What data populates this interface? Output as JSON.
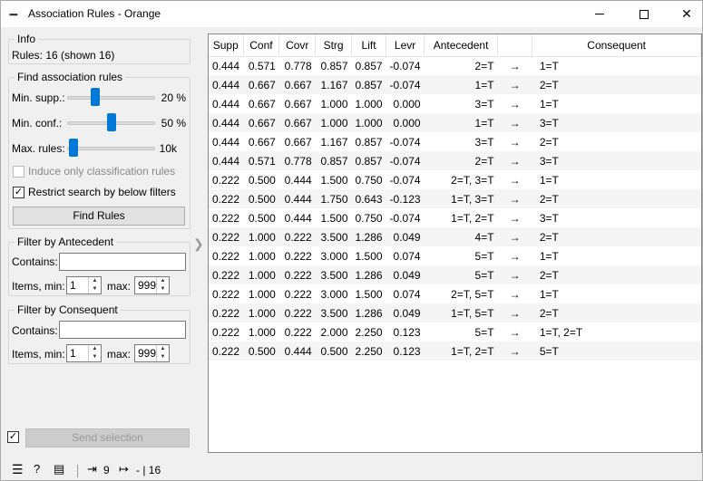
{
  "window": {
    "title": "Association Rules - Orange",
    "app_icon": "orange-dots-icon"
  },
  "info": {
    "title": "Info",
    "rules_text": "Rules: 16 (shown 16)"
  },
  "find": {
    "title": "Find association rules",
    "min_supp_label": "Min. supp.:",
    "min_supp_value": "20 %",
    "min_supp_level": 0.3,
    "min_conf_label": "Min. conf.:",
    "min_conf_value": "50 %",
    "min_conf_level": 0.5,
    "max_rules_label": "Max. rules:",
    "max_rules_value": "10k",
    "max_rules_level": 0.02,
    "induce_label": "Induce only classification rules",
    "induce_checked": false,
    "restrict_label": "Restrict search by below filters",
    "restrict_checked": true,
    "find_button": "Find Rules"
  },
  "filter_antecedent": {
    "title": "Filter by Antecedent",
    "contains_label": "Contains:",
    "contains_value": "",
    "items_min_label": "Items, min:",
    "items_min_value": "1",
    "max_label": "max:",
    "max_value": "999"
  },
  "filter_consequent": {
    "title": "Filter by Consequent",
    "contains_label": "Contains:",
    "contains_value": "",
    "items_min_label": "Items, min:",
    "items_min_value": "1",
    "max_label": "max:",
    "max_value": "999"
  },
  "send": {
    "auto_send_checked": true,
    "button": "Send selection"
  },
  "table": {
    "headers": [
      "Supp",
      "Conf",
      "Covr",
      "Strg",
      "Lift",
      "Levr",
      "Antecedent",
      "",
      "Consequent"
    ],
    "rows": [
      [
        "0.444",
        "0.571",
        "0.778",
        "0.857",
        "0.857",
        "-0.074",
        "2=T",
        "→",
        "1=T"
      ],
      [
        "0.444",
        "0.667",
        "0.667",
        "1.167",
        "0.857",
        "-0.074",
        "1=T",
        "→",
        "2=T"
      ],
      [
        "0.444",
        "0.667",
        "0.667",
        "1.000",
        "1.000",
        "0.000",
        "3=T",
        "→",
        "1=T"
      ],
      [
        "0.444",
        "0.667",
        "0.667",
        "1.000",
        "1.000",
        "0.000",
        "1=T",
        "→",
        "3=T"
      ],
      [
        "0.444",
        "0.667",
        "0.667",
        "1.167",
        "0.857",
        "-0.074",
        "3=T",
        "→",
        "2=T"
      ],
      [
        "0.444",
        "0.571",
        "0.778",
        "0.857",
        "0.857",
        "-0.074",
        "2=T",
        "→",
        "3=T"
      ],
      [
        "0.222",
        "0.500",
        "0.444",
        "1.500",
        "0.750",
        "-0.074",
        "2=T, 3=T",
        "→",
        "1=T"
      ],
      [
        "0.222",
        "0.500",
        "0.444",
        "1.750",
        "0.643",
        "-0.123",
        "1=T, 3=T",
        "→",
        "2=T"
      ],
      [
        "0.222",
        "0.500",
        "0.444",
        "1.500",
        "0.750",
        "-0.074",
        "1=T, 2=T",
        "→",
        "3=T"
      ],
      [
        "0.222",
        "1.000",
        "0.222",
        "3.500",
        "1.286",
        "0.049",
        "4=T",
        "→",
        "2=T"
      ],
      [
        "0.222",
        "1.000",
        "0.222",
        "3.000",
        "1.500",
        "0.074",
        "5=T",
        "→",
        "1=T"
      ],
      [
        "0.222",
        "1.000",
        "0.222",
        "3.500",
        "1.286",
        "0.049",
        "5=T",
        "→",
        "2=T"
      ],
      [
        "0.222",
        "1.000",
        "0.222",
        "3.000",
        "1.500",
        "0.074",
        "2=T, 5=T",
        "→",
        "1=T"
      ],
      [
        "0.222",
        "1.000",
        "0.222",
        "3.500",
        "1.286",
        "0.049",
        "1=T, 5=T",
        "→",
        "2=T"
      ],
      [
        "0.222",
        "1.000",
        "0.222",
        "2.000",
        "2.250",
        "0.123",
        "5=T",
        "→",
        "1=T, 2=T"
      ],
      [
        "0.222",
        "0.500",
        "0.444",
        "0.500",
        "2.250",
        "0.123",
        "1=T, 2=T",
        "→",
        "5=T"
      ]
    ]
  },
  "statusbar": {
    "input_count": "9",
    "output_count": "- | 16"
  }
}
